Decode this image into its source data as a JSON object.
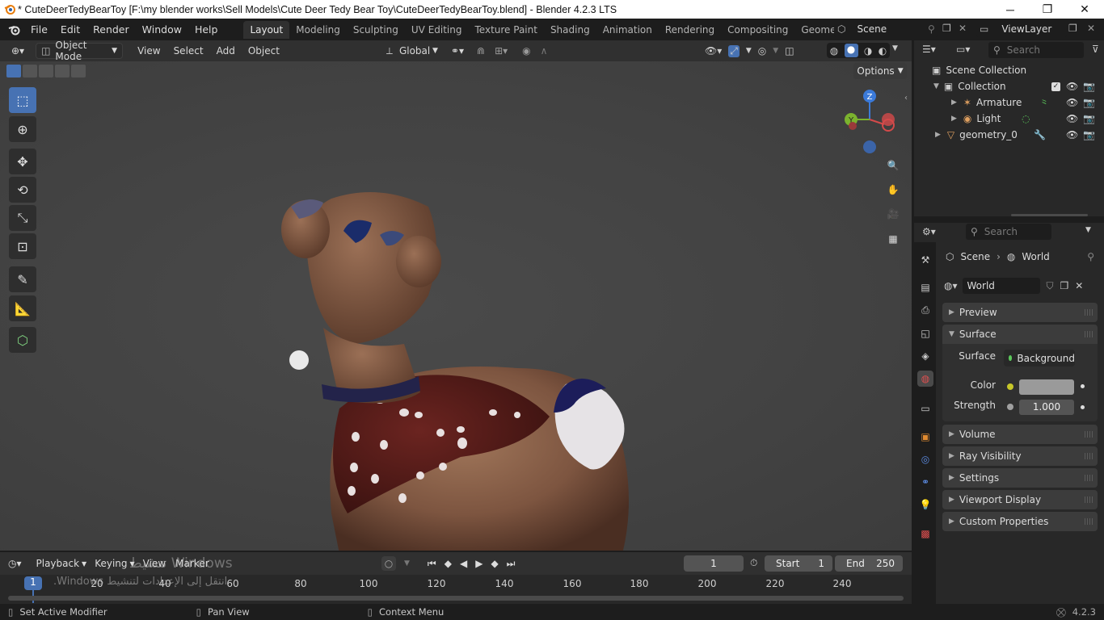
{
  "window": {
    "title": "* CuteDeerTedyBearToy [F:\\my blender works\\Sell Models\\Cute Deer Tedy Bear Toy\\CuteDeerTedyBearToy.blend] - Blender 4.2.3 LTS",
    "min": "─",
    "max": "❐",
    "close": "✕"
  },
  "menu": [
    "File",
    "Edit",
    "Render",
    "Window",
    "Help"
  ],
  "workspaces": [
    "Layout",
    "Modeling",
    "Sculpting",
    "UV Editing",
    "Texture Paint",
    "Shading",
    "Animation",
    "Rendering",
    "Compositing",
    "Geometry Nodes"
  ],
  "active_workspace": "Layout",
  "scene_field": "Scene",
  "viewlayer_field": "ViewLayer",
  "viewport_header": {
    "mode": "Object Mode",
    "menus": [
      "View",
      "Select",
      "Add",
      "Object"
    ],
    "orientation": "Global",
    "options": "Options"
  },
  "gizmo": {
    "x": "X",
    "y": "Y",
    "z": "Z"
  },
  "outliner": {
    "search_placeholder": "Search",
    "rows": [
      {
        "label": "Scene Collection",
        "indent": 0
      },
      {
        "label": "Collection",
        "indent": 1
      },
      {
        "label": "Armature",
        "indent": 2
      },
      {
        "label": "Light",
        "indent": 2
      },
      {
        "label": "geometry_0",
        "indent": 1
      }
    ]
  },
  "properties": {
    "search_placeholder": "Search",
    "breadcrumb_scene": "Scene",
    "breadcrumb_world": "World",
    "world_name": "World",
    "panels": {
      "preview": "Preview",
      "surface": "Surface",
      "volume": "Volume",
      "ray_visibility": "Ray Visibility",
      "settings": "Settings",
      "viewport_display": "Viewport Display",
      "custom_properties": "Custom Properties"
    },
    "surface_label": "Surface",
    "surface_value": "Background",
    "color_label": "Color",
    "strength_label": "Strength",
    "strength_value": "1.000",
    "color_swatch": "#9a9a9a"
  },
  "timeline": {
    "menus": [
      "Playback",
      "Keying",
      "View",
      "Marker"
    ],
    "current_frame": "1",
    "start_label": "Start",
    "start_value": "1",
    "end_label": "End",
    "end_value": "250",
    "ticks": [
      "20",
      "40",
      "60",
      "80",
      "100",
      "120",
      "140",
      "160",
      "180",
      "200",
      "220",
      "240"
    ],
    "playhead": "1"
  },
  "watermark": {
    "line1": "تنشيط Windows",
    "line2": "انتقل إلى الإعدادات لتنشيط Windows."
  },
  "status": {
    "left": "Set Active Modifier",
    "middle": "Pan View",
    "right": "Context Menu",
    "version": "4.2.3"
  },
  "colors": {
    "accent": "#4772b3",
    "header": "#303030",
    "panel": "#3c3c3c",
    "bg": "#1d1d1d"
  }
}
